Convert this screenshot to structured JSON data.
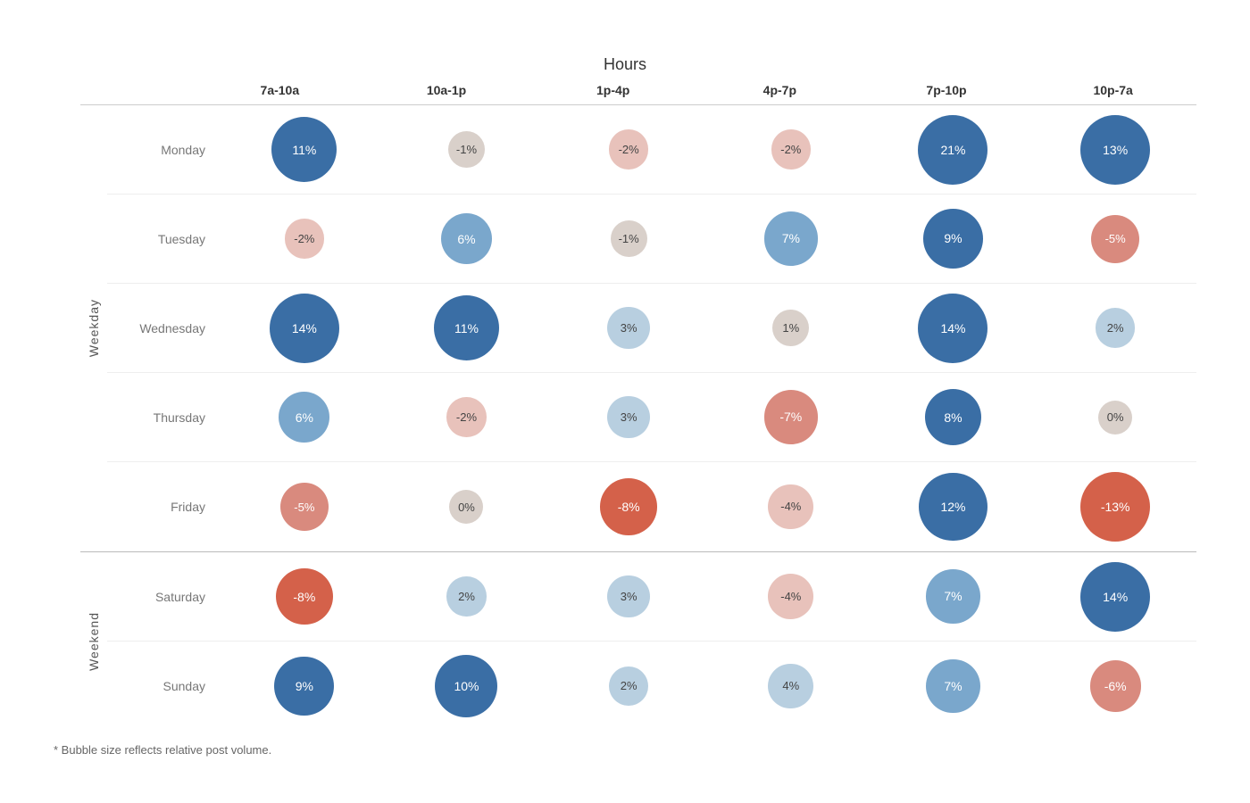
{
  "title": "Hours",
  "columns": [
    "7a-10a",
    "10a-1p",
    "1p-4p",
    "4p-7p",
    "7p-10p",
    "10p-7a"
  ],
  "sections": [
    {
      "label": "Weekday",
      "rows": [
        {
          "day": "Monday",
          "cells": [
            {
              "value": 11,
              "display": "11%"
            },
            {
              "value": -1,
              "display": "-1%"
            },
            {
              "value": -2,
              "display": "-2%"
            },
            {
              "value": -2,
              "display": "-2%"
            },
            {
              "value": 21,
              "display": "21%"
            },
            {
              "value": 13,
              "display": "13%"
            }
          ]
        },
        {
          "day": "Tuesday",
          "cells": [
            {
              "value": -2,
              "display": "-2%"
            },
            {
              "value": 6,
              "display": "6%"
            },
            {
              "value": -1,
              "display": "-1%"
            },
            {
              "value": 7,
              "display": "7%"
            },
            {
              "value": 9,
              "display": "9%"
            },
            {
              "value": -5,
              "display": "-5%"
            }
          ]
        },
        {
          "day": "Wednesday",
          "cells": [
            {
              "value": 14,
              "display": "14%"
            },
            {
              "value": 11,
              "display": "11%"
            },
            {
              "value": 3,
              "display": "3%"
            },
            {
              "value": 1,
              "display": "1%"
            },
            {
              "value": 14,
              "display": "14%"
            },
            {
              "value": 2,
              "display": "2%"
            }
          ]
        },
        {
          "day": "Thursday",
          "cells": [
            {
              "value": 6,
              "display": "6%"
            },
            {
              "value": -2,
              "display": "-2%"
            },
            {
              "value": 3,
              "display": "3%"
            },
            {
              "value": -7,
              "display": "-7%"
            },
            {
              "value": 8,
              "display": "8%"
            },
            {
              "value": 0,
              "display": "0%"
            }
          ]
        },
        {
          "day": "Friday",
          "cells": [
            {
              "value": -5,
              "display": "-5%"
            },
            {
              "value": 0,
              "display": "0%"
            },
            {
              "value": -8,
              "display": "-8%"
            },
            {
              "value": -4,
              "display": "-4%"
            },
            {
              "value": 12,
              "display": "12%"
            },
            {
              "value": -13,
              "display": "-13%"
            }
          ]
        }
      ]
    },
    {
      "label": "Weekend",
      "rows": [
        {
          "day": "Saturday",
          "cells": [
            {
              "value": -8,
              "display": "-8%"
            },
            {
              "value": 2,
              "display": "2%"
            },
            {
              "value": 3,
              "display": "3%"
            },
            {
              "value": -4,
              "display": "-4%"
            },
            {
              "value": 7,
              "display": "7%"
            },
            {
              "value": 14,
              "display": "14%"
            }
          ]
        },
        {
          "day": "Sunday",
          "cells": [
            {
              "value": 9,
              "display": "9%"
            },
            {
              "value": 10,
              "display": "10%"
            },
            {
              "value": 2,
              "display": "2%"
            },
            {
              "value": 4,
              "display": "4%"
            },
            {
              "value": 7,
              "display": "7%"
            },
            {
              "value": -6,
              "display": "-6%"
            }
          ]
        }
      ]
    }
  ],
  "footnote": "* Bubble size reflects relative post volume.",
  "colors": {
    "positive_strong": "#3a6ea5",
    "positive_medium": "#7aa7cc",
    "positive_light": "#b8cfe0",
    "neutral": "#d9d0ca",
    "negative_light": "#e8c2bb",
    "negative_medium": "#d98a7e",
    "negative_strong": "#d4614a"
  }
}
